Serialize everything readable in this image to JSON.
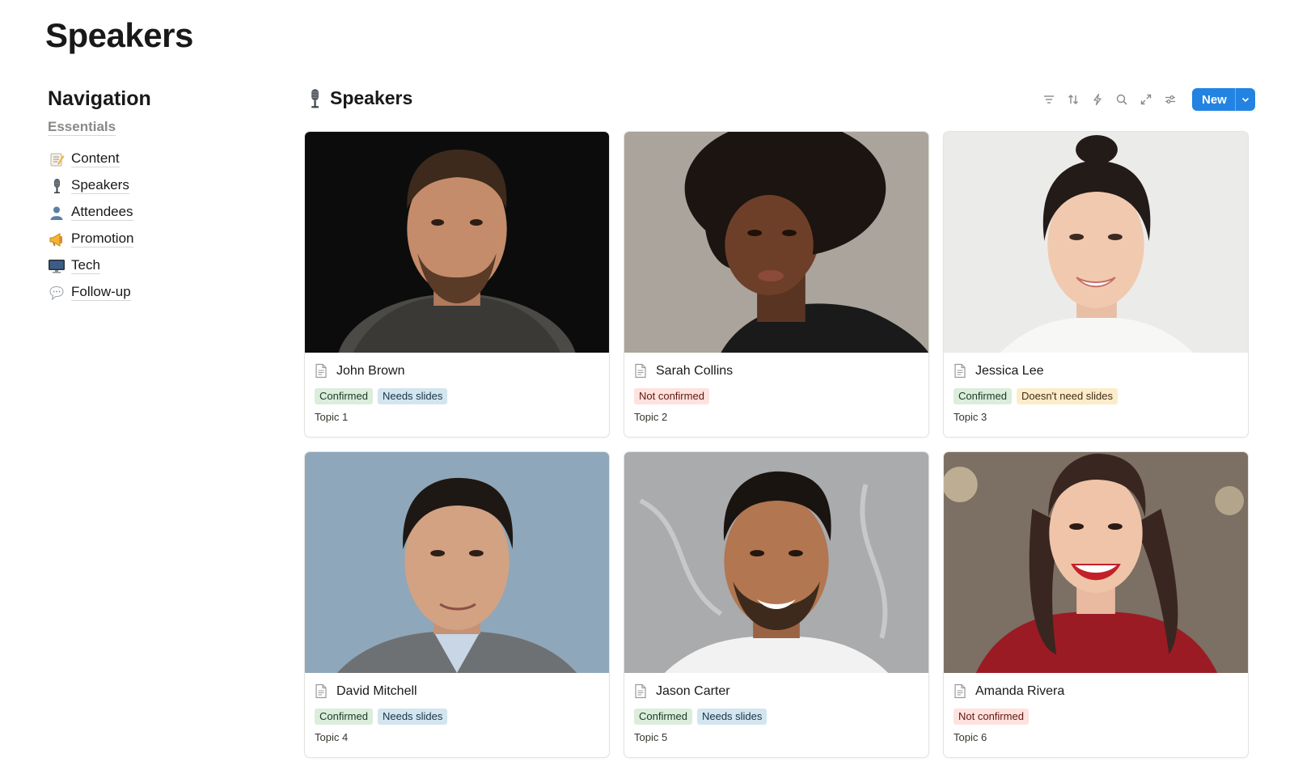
{
  "page": {
    "title": "Speakers"
  },
  "sidebar": {
    "heading": "Navigation",
    "section": "Essentials",
    "items": [
      {
        "emoji": "memo-icon",
        "label": "Content"
      },
      {
        "emoji": "microphone-icon",
        "label": "Speakers"
      },
      {
        "emoji": "person-icon",
        "label": "Attendees"
      },
      {
        "emoji": "megaphone-icon",
        "label": "Promotion"
      },
      {
        "emoji": "monitor-icon",
        "label": "Tech"
      },
      {
        "emoji": "speech-bubble-icon",
        "label": "Follow-up"
      }
    ]
  },
  "database": {
    "title": "Speakers",
    "icon": "microphone-icon",
    "toolbar": [
      "filter-icon",
      "sort-icon",
      "lightning-icon",
      "search-icon",
      "expand-icon",
      "settings-sliders-icon"
    ],
    "new_label": "New"
  },
  "colors": {
    "accent": "#2383e2"
  },
  "cards": [
    {
      "name": "John Brown",
      "tags": [
        {
          "label": "Confirmed",
          "color": "green"
        },
        {
          "label": "Needs slides",
          "color": "blue"
        }
      ],
      "topic": "Topic 1",
      "portrait": "dark background, man with beard"
    },
    {
      "name": "Sarah Collins",
      "tags": [
        {
          "label": "Not confirmed",
          "color": "red"
        }
      ],
      "topic": "Topic 2",
      "portrait": "grey background, woman with natural hair"
    },
    {
      "name": "Jessica Lee",
      "tags": [
        {
          "label": "Confirmed",
          "color": "green"
        },
        {
          "label": "Doesn't need slides",
          "color": "yellow"
        }
      ],
      "topic": "Topic 3",
      "portrait": "light background, smiling woman"
    },
    {
      "name": "David Mitchell",
      "tags": [
        {
          "label": "Confirmed",
          "color": "green"
        },
        {
          "label": "Needs slides",
          "color": "blue"
        }
      ],
      "topic": "Topic 4",
      "portrait": "blue background, man"
    },
    {
      "name": "Jason Carter",
      "tags": [
        {
          "label": "Confirmed",
          "color": "green"
        },
        {
          "label": "Needs slides",
          "color": "blue"
        }
      ],
      "topic": "Topic 5",
      "portrait": "marble background, smiling man"
    },
    {
      "name": "Amanda Rivera",
      "tags": [
        {
          "label": "Not confirmed",
          "color": "red"
        }
      ],
      "topic": "Topic 6",
      "portrait": "warm background, woman in red"
    }
  ]
}
